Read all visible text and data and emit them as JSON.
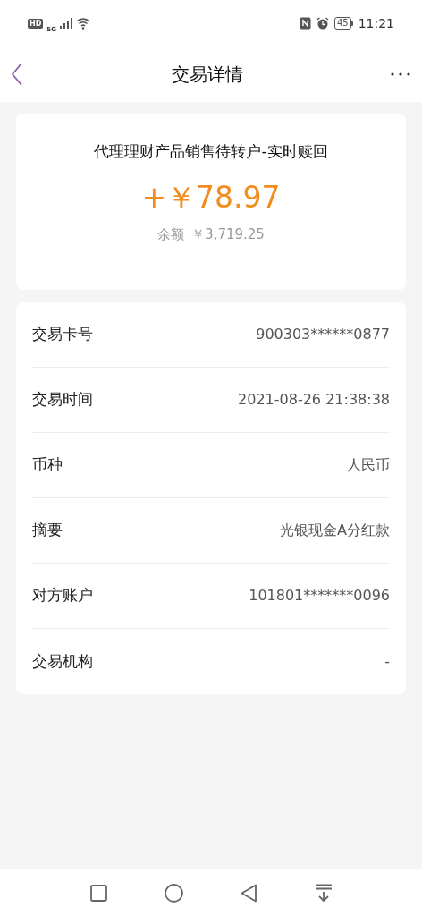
{
  "status_bar": {
    "hd": "HD",
    "network": "5G",
    "battery": "45",
    "time": "11:21"
  },
  "header": {
    "title": "交易详情"
  },
  "summary": {
    "description": "代理理财产品销售待转户-实时赎回",
    "amount": "+￥78.97",
    "balance_label": "余额",
    "balance": "￥3,719.25"
  },
  "details": [
    {
      "label": "交易卡号",
      "value": "900303******0877"
    },
    {
      "label": "交易时间",
      "value": "2021-08-26 21:38:38"
    },
    {
      "label": "币种",
      "value": "人民币"
    },
    {
      "label": "摘要",
      "value": "光银现金A分红款"
    },
    {
      "label": "对方账户",
      "value": "101801*******0096"
    },
    {
      "label": "交易机构",
      "value": "-"
    }
  ]
}
